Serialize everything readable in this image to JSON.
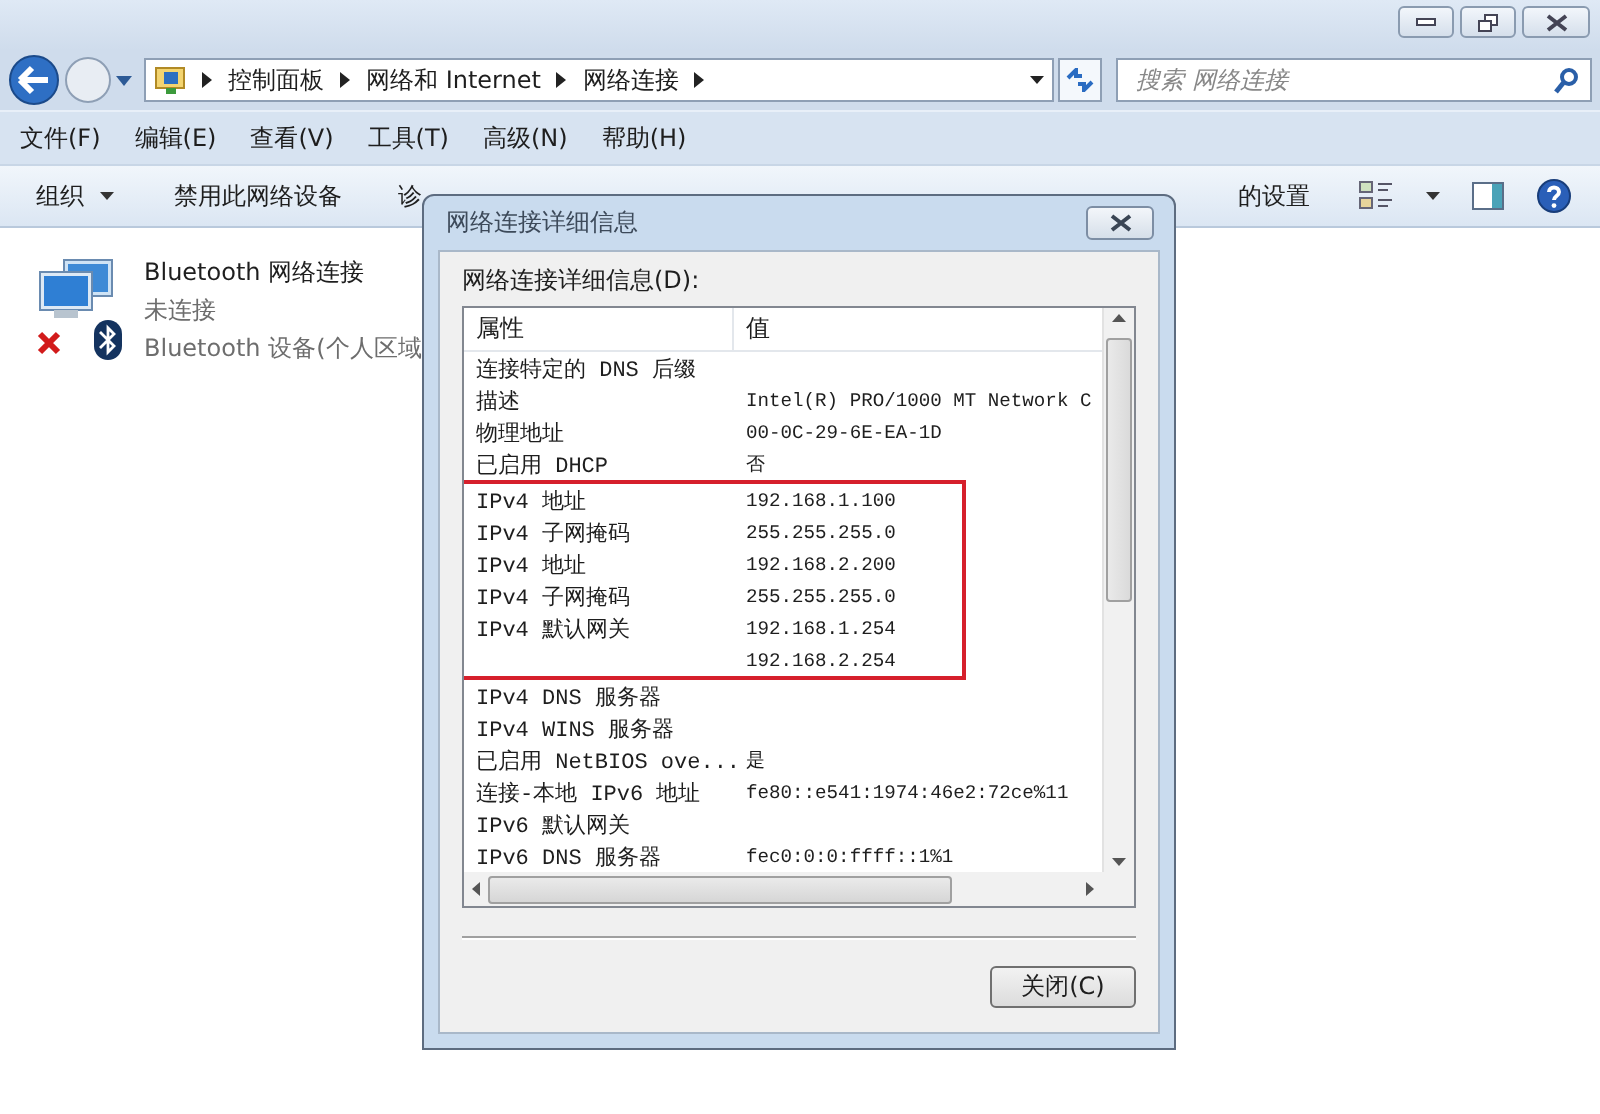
{
  "address_bar": {
    "breadcrumbs": [
      "控制面板",
      "网络和 Internet",
      "网络连接"
    ]
  },
  "search": {
    "placeholder": "搜索 网络连接"
  },
  "menu": [
    "文件(F)",
    "编辑(E)",
    "查看(V)",
    "工具(T)",
    "高级(N)",
    "帮助(H)"
  ],
  "toolbar": {
    "items": [
      {
        "label": "组织",
        "kind": "dropdown"
      },
      {
        "label": "禁用此网络设备",
        "kind": "button"
      },
      {
        "label": "诊",
        "kind": "button"
      },
      {
        "label": "的设置",
        "kind": "button"
      }
    ]
  },
  "connections": [
    {
      "name": "Bluetooth 网络连接",
      "status": "未连接",
      "device": "Bluetooth 设备(个人区域",
      "connected": false
    }
  ],
  "dialog": {
    "title": "网络连接详细信息",
    "label": "网络连接详细信息(D):",
    "columns": [
      "属性",
      "值"
    ],
    "rows": [
      {
        "property": "连接特定的 DNS 后缀",
        "value": "",
        "highlighted": false
      },
      {
        "property": "描述",
        "value": "Intel(R) PRO/1000 MT Network C",
        "highlighted": false
      },
      {
        "property": "物理地址",
        "value": "00-0C-29-6E-EA-1D",
        "highlighted": false
      },
      {
        "property": "已启用 DHCP",
        "value": "否",
        "highlighted": false
      },
      {
        "property": "IPv4 地址",
        "value": "192.168.1.100",
        "highlighted": true
      },
      {
        "property": "IPv4 子网掩码",
        "value": "255.255.255.0",
        "highlighted": true
      },
      {
        "property": "IPv4 地址",
        "value": "192.168.2.200",
        "highlighted": true
      },
      {
        "property": "IPv4 子网掩码",
        "value": "255.255.255.0",
        "highlighted": true
      },
      {
        "property": "IPv4 默认网关",
        "value": "192.168.1.254",
        "highlighted": true
      },
      {
        "property": "",
        "value": "192.168.2.254",
        "highlighted": true
      },
      {
        "property": "IPv4 DNS 服务器",
        "value": "",
        "highlighted": false
      },
      {
        "property": "IPv4 WINS 服务器",
        "value": "",
        "highlighted": false
      },
      {
        "property": "已启用 NetBIOS ove...",
        "value": "是",
        "highlighted": false
      },
      {
        "property": "连接-本地 IPv6 地址",
        "value": "fe80::e541:1974:46e2:72ce%11",
        "highlighted": false
      },
      {
        "property": "IPv6 默认网关",
        "value": "",
        "highlighted": false
      },
      {
        "property": "IPv6 DNS 服务器",
        "value": "fec0:0:0:ffff::1%1",
        "highlighted": false
      }
    ],
    "close_button": "关闭(C)"
  }
}
